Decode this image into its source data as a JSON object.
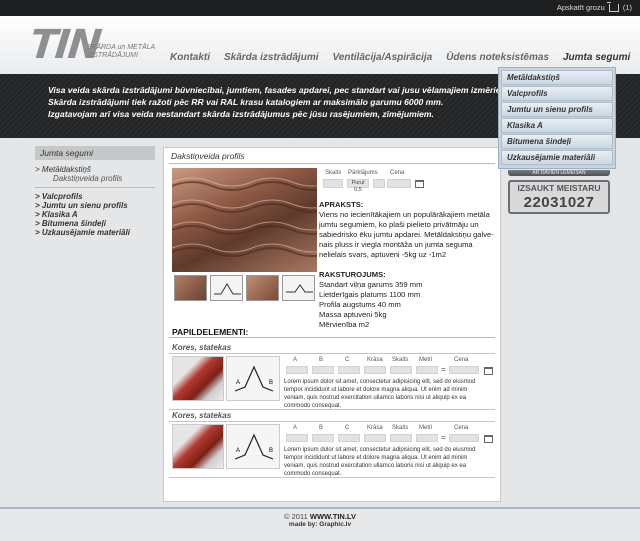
{
  "topbar": {
    "cart_label": "Apskatīt grozu",
    "cart_count": "(1)"
  },
  "logo": {
    "name": "TIN",
    "line1": "SKĀRDA un METĀLA",
    "line2": "IZSTRĀDĀJUMI"
  },
  "nav": [
    {
      "label": "Kontakti"
    },
    {
      "label": "Skārda izstrādājumi"
    },
    {
      "label": "Ventilācija/Aspirācija"
    },
    {
      "label": "Ūdens noteksistēmas"
    },
    {
      "label": "Jumta segumi"
    }
  ],
  "banner": {
    "line1": "Visa veida skārda izstrādājumi būvniecībai, jumtiem, fasades apdarei, pec standart vai jusu vēlamajiem izmēriem.",
    "line2": "Skārda izstrādājumi tiek ražoti pēc RR vai RAL krasu katalogiem ar maksimālo garumu 6000 mm.",
    "line3": "Izgatavojam arī visa veida nestandart skārda izstrādājumus pēc jūsu rasējumiem, zīmējumiem."
  },
  "dropdown": [
    {
      "label": "Metāldakstiņš"
    },
    {
      "label": "Valcprofils"
    },
    {
      "label": "Jumtu un sienu profils"
    },
    {
      "label": "Klasika A"
    },
    {
      "label": "Bitumena šindeļi"
    },
    {
      "label": "Uzkausējamie materiāli"
    }
  ],
  "sidebar": {
    "heading": "Jumta segumi",
    "active_item": "Metāldakstiņš",
    "active_sub": "Dakstiņveida profils",
    "items": [
      "Valcprofils",
      "Jumtu un sienu profils",
      "Klasika A",
      "Bitumena šindeļi",
      "Uzkausējamie materiāli"
    ]
  },
  "product": {
    "title": "Dakstiņveida profils",
    "col_count": "Skaits",
    "col_length": "Pārklājums",
    "col_price": "Cena",
    "unit": "Purul 0,5",
    "apraksts_h": "APRAKSTS:",
    "apraksts": "Viens no iecienītākajiem un populārākajiem metāla jumtu segumiem, ko plaši pielieto privātmāju un sabiedrisko ēku jumtu apdarei. Metāldakstiņu galve-nais pluss ir viegla montāža un jumta seguma nelielais svars, aptuveni -5kg uz -1m2",
    "raksturojums_h": "RAKSTUROJUMS:",
    "specs": [
      "Standart viļņa garums 359 mm",
      "Lietderīgais platums 1100 mm",
      "Profila augstums 40 mm",
      "Massa aptuveni  5kg",
      "Mērvienība  m2"
    ]
  },
  "papildelementi": {
    "heading": "PAPILDELEMENTI:",
    "columns": [
      "A",
      "B",
      "C",
      "Krāsa",
      "Skaits",
      "Metri",
      "Cena"
    ],
    "items": [
      {
        "title": "Kores, statekas",
        "text": "Lorem ipsum dolor sit amet, consectetur adipisicing elit, sed do eiusmod tempor incididunt ut labore et dolore magna aliqua. Ut enim ad minim veniam, quis nostrud exercitation ullamco laboris nisi ut aliquip ex ea commodo consequat."
      },
      {
        "title": "Kores, statekas",
        "text": "Lorem ipsum dolor sit amet, consectetur adipisicing elit, sed do eiusmod tempor incididunt ut labore et dolore magna aliqua. Ut enim ad minim veniam, quis nostrud exercitation ullamco laboris nisi ut aliquip ex ea commodo consequat."
      }
    ]
  },
  "right": {
    "strip_label": "AR DAVIEN LEMEISAN",
    "call_label": "IZSAUKT MEISTARU",
    "phone": "22031027"
  },
  "footer": {
    "copyright": "© 2011",
    "site": "WWW.TIN.LV",
    "made_by": "made by: Graphic.lv"
  },
  "colors": {
    "banner": "#262729",
    "dropdown": "#c9d4df",
    "footer_line": "#a9b7c4"
  }
}
